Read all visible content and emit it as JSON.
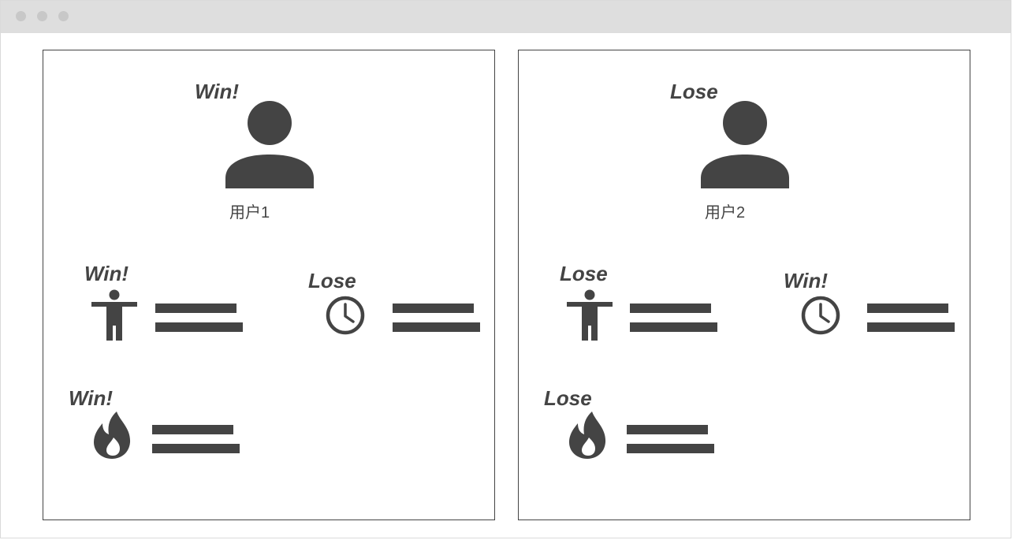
{
  "window": {
    "controls": [
      "close",
      "minimize",
      "maximize"
    ]
  },
  "players": [
    {
      "name": "用户1",
      "overall": "Win!",
      "stats": [
        {
          "icon": "person-arms-out-icon",
          "result": "Win!"
        },
        {
          "icon": "clock-icon",
          "result": "Lose"
        },
        {
          "icon": "flame-icon",
          "result": "Win!"
        }
      ]
    },
    {
      "name": "用户2",
      "overall": "Lose",
      "stats": [
        {
          "icon": "person-arms-out-icon",
          "result": "Lose"
        },
        {
          "icon": "clock-icon",
          "result": "Win!"
        },
        {
          "icon": "flame-icon",
          "result": "Lose"
        }
      ]
    }
  ],
  "colors": {
    "foreground": "#444444",
    "titlebar": "#dedede",
    "window_controls": "#c8c8c8"
  }
}
